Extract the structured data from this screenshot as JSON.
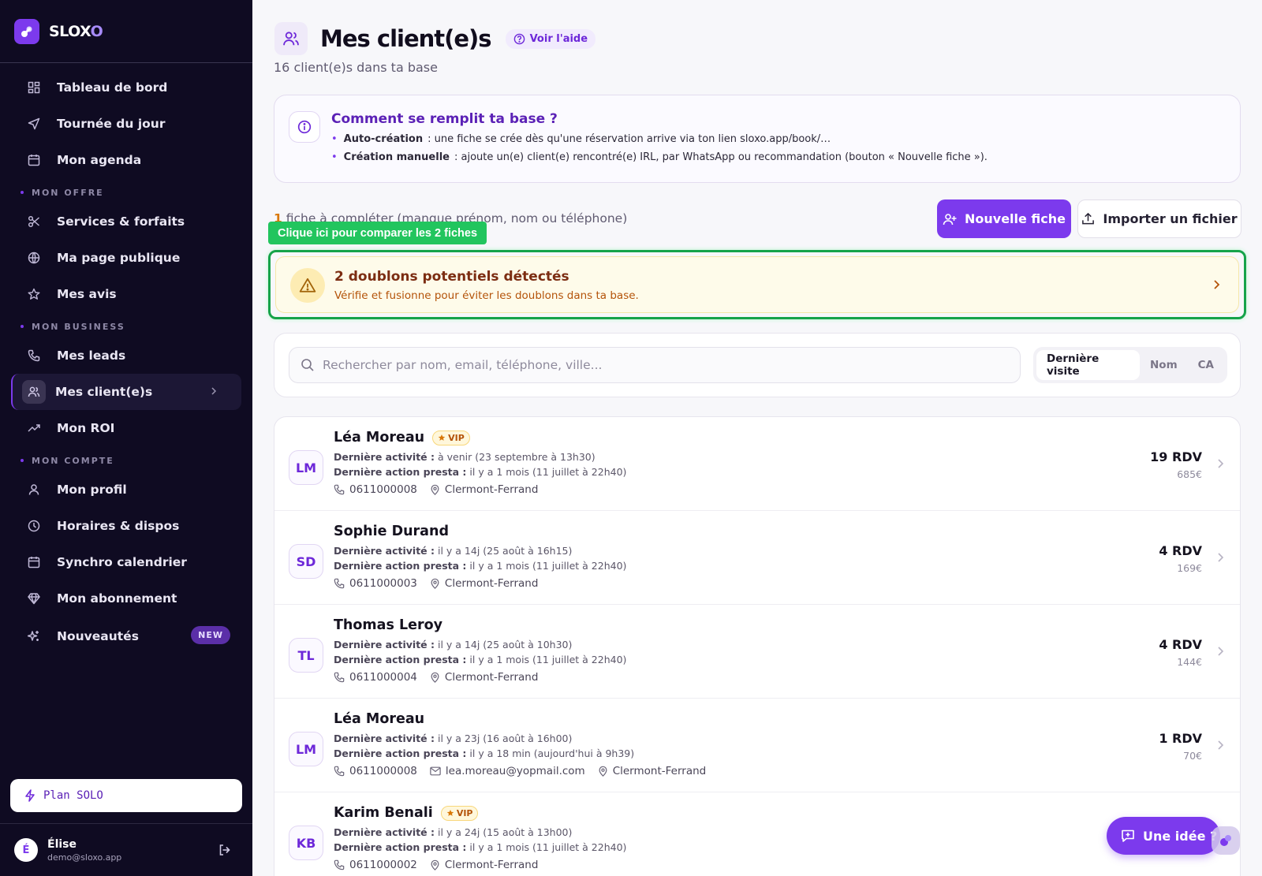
{
  "brand": {
    "name_main": "SLOX",
    "name_accent": "O"
  },
  "sidebar": {
    "items_top": [
      {
        "label": "Tableau de bord",
        "icon": "dashboard-icon"
      },
      {
        "label": "Tournée du jour",
        "icon": "send-icon"
      },
      {
        "label": "Mon agenda",
        "icon": "calendar-icon"
      }
    ],
    "section_offre": "MON OFFRE",
    "items_offre": [
      {
        "label": "Services & forfaits",
        "icon": "scissors-icon"
      },
      {
        "label": "Ma page publique",
        "icon": "globe-icon"
      },
      {
        "label": "Mes avis",
        "icon": "star-icon"
      }
    ],
    "section_business": "MON BUSINESS",
    "items_business": [
      {
        "label": "Mes leads",
        "icon": "phone-icon"
      },
      {
        "label": "Mes client(e)s",
        "icon": "users-icon",
        "active": true
      },
      {
        "label": "Mon ROI",
        "icon": "trending-up-icon"
      }
    ],
    "section_compte": "MON COMPTE",
    "items_compte": [
      {
        "label": "Mon profil",
        "icon": "user-icon"
      },
      {
        "label": "Horaires & dispos",
        "icon": "clock-icon"
      },
      {
        "label": "Synchro calendrier",
        "icon": "calendar-sync-icon"
      },
      {
        "label": "Mon abonnement",
        "icon": "gem-icon"
      },
      {
        "label": "Nouveautés",
        "icon": "sparkles-icon",
        "badge": "NEW"
      }
    ],
    "plan": "Plan SOLO",
    "user": {
      "initial": "É",
      "name": "Élise",
      "email": "demo@sloxo.app"
    }
  },
  "header": {
    "title": "Mes client(e)s",
    "help": "Voir l'aide",
    "subtitle": "16 client(e)s dans ta base"
  },
  "info": {
    "title": "Comment se remplit ta base ?",
    "items": [
      {
        "bold": "Auto-création",
        "text": ": une fiche se crée dès qu'une réservation arrive via ton lien sloxo.app/book/…"
      },
      {
        "bold": "Création manuelle",
        "text": ": ajoute un(e) client(e) rencontré(e) IRL, par WhatsApp ou recommandation (bouton « Nouvelle fiche »)."
      }
    ]
  },
  "completion": {
    "count": "1",
    "text": "fiche à compléter (manque prénom, nom ou téléphone)"
  },
  "actions": {
    "new": "Nouvelle fiche",
    "import": "Importer un fichier"
  },
  "tooltip": "Clique ici pour comparer les 2 fiches",
  "duplicates": {
    "title": "2 doublons potentiels détectés",
    "text": "Vérifie et fusionne pour éviter les doublons dans ta base."
  },
  "search": {
    "placeholder": "Rechercher par nom, email, téléphone, ville..."
  },
  "sort_options": [
    "Dernière visite",
    "Nom",
    "CA"
  ],
  "sort_selected": "Dernière visite",
  "labels": {
    "last_activity": "Dernière activité :",
    "last_action": "Dernière action presta :"
  },
  "clients": [
    {
      "initials": "LM",
      "name": "Léa Moreau",
      "vip": "VIP",
      "activity": "à venir (23 septembre à 13h30)",
      "action": "il y a 1 mois (11 juillet à 22h40)",
      "phone": "0611000008",
      "email": "",
      "city": "Clermont-Ferrand",
      "rdv": "19 RDV",
      "ca": "685€"
    },
    {
      "initials": "SD",
      "name": "Sophie Durand",
      "vip": "",
      "activity": "il y a 14j (25 août à 16h15)",
      "action": "il y a 1 mois (11 juillet à 22h40)",
      "phone": "0611000003",
      "email": "",
      "city": "Clermont-Ferrand",
      "rdv": "4 RDV",
      "ca": "169€"
    },
    {
      "initials": "TL",
      "name": "Thomas Leroy",
      "vip": "",
      "activity": "il y a 14j (25 août à 10h30)",
      "action": "il y a 1 mois (11 juillet à 22h40)",
      "phone": "0611000004",
      "email": "",
      "city": "Clermont-Ferrand",
      "rdv": "4 RDV",
      "ca": "144€"
    },
    {
      "initials": "LM",
      "name": "Léa Moreau",
      "vip": "",
      "activity": "il y a 23j (16 août à 16h00)",
      "action": "il y a 18 min (aujourd'hui à 9h39)",
      "phone": "0611000008",
      "email": "lea.moreau@yopmail.com",
      "city": "Clermont-Ferrand",
      "rdv": "1 RDV",
      "ca": "70€"
    },
    {
      "initials": "KB",
      "name": "Karim Benali",
      "vip": "VIP",
      "activity": "il y a 24j (15 août à 13h00)",
      "action": "il y a 1 mois (11 juillet à 22h40)",
      "phone": "0611000002",
      "email": "",
      "city": "Clermont-Ferrand",
      "rdv": "",
      "ca": ""
    }
  ],
  "fab": "Une idée ?"
}
